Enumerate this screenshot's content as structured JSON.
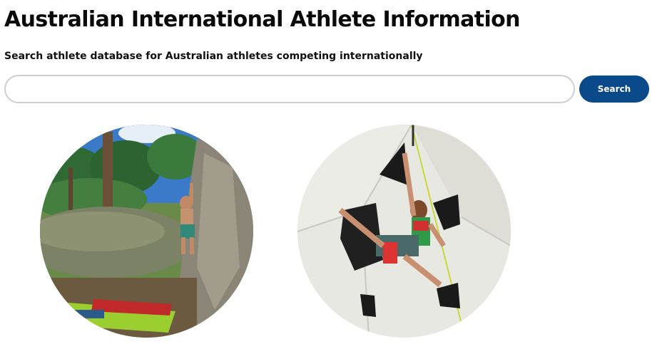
{
  "page": {
    "title": "Australian International Athlete Information",
    "subtitle": "Search athlete database for Australian athletes competing internationally"
  },
  "search": {
    "value": "",
    "placeholder": "",
    "button_label": "Search"
  },
  "athlete_photos": [
    {
      "scene": "outdoor bouldering climber on rock in forest"
    },
    {
      "scene": "indoor competition climber on wall with volumes"
    }
  ],
  "colors": {
    "button_bg": "#0a4a8a",
    "button_text": "#ffffff",
    "input_border": "#cfcfcf",
    "title_text": "#0a0a0a"
  }
}
